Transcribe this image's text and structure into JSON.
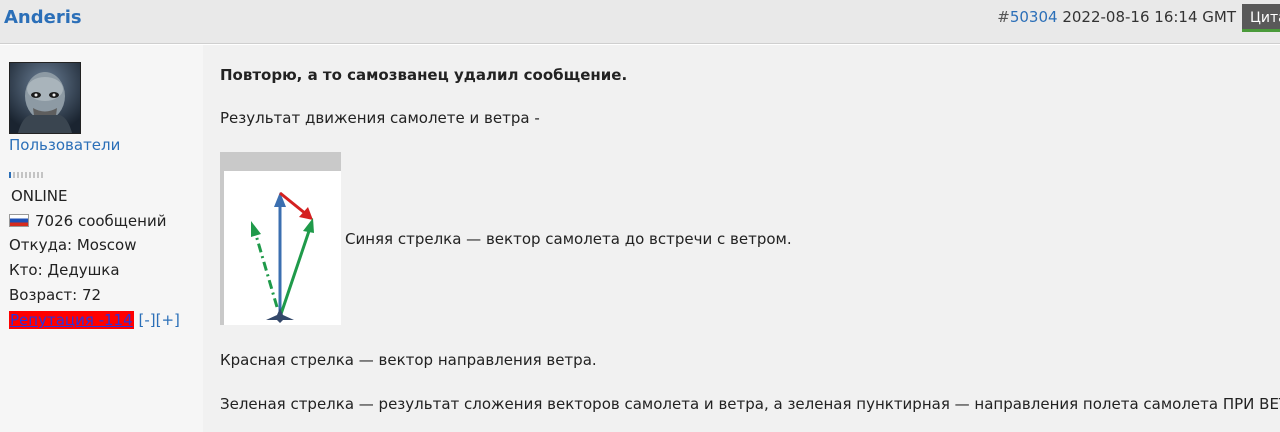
{
  "post": {
    "author": "Anderis",
    "hash": "#",
    "post_id": "50304",
    "datetime": "2022-08-16 16:14 GMT",
    "quote_label": "Цитата"
  },
  "user": {
    "group": "Пользователи",
    "status": "ONLINE",
    "messages": "7026 сообщений",
    "from": "Откуда: Moscow",
    "who": "Кто: Дедушка",
    "age": "Возраст: 72",
    "reputation": "Репутация -114",
    "rep_minus": "[-]",
    "rep_plus": "[+]"
  },
  "message": {
    "intro": "Повторю, а то самозванец удалил сообщение.",
    "line1": "Результат движения самолете и ветра -",
    "caption_blue": "Синяя стрелка — вектор самолета до встречи с ветром.",
    "caption_red": "Красная стрелка — вектор направления ветра.",
    "caption_green": "Зеленая стрелка — результат сложения векторов самолета и ветра, а зеленая пунктирная — направления полета самолета ПРИ ВЕТРЕ."
  },
  "colors": {
    "link": "#2b6fb8",
    "arrow_blue": "#3b6fb0",
    "arrow_red": "#d42020",
    "arrow_green": "#1f9a4a"
  }
}
